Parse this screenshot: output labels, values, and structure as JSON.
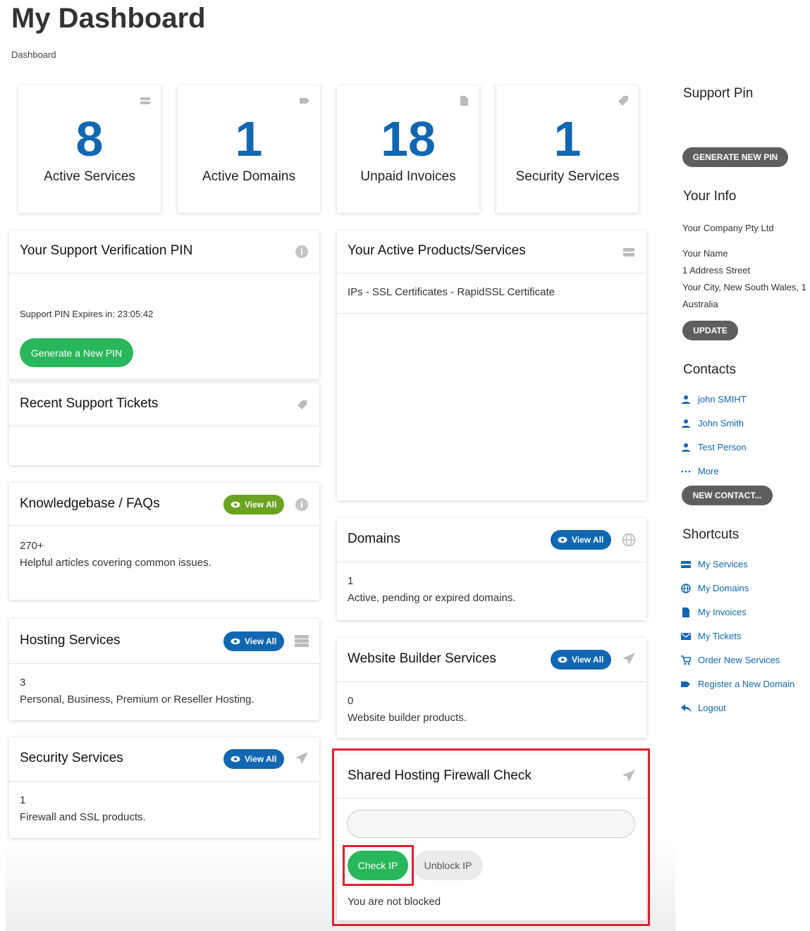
{
  "page": {
    "title": "My Dashboard",
    "breadcrumb": "Dashboard"
  },
  "tiles": [
    {
      "count": "8",
      "label": "Active Services",
      "icon": "server-icon"
    },
    {
      "count": "1",
      "label": "Active Domains",
      "icon": "tag-icon"
    },
    {
      "count": "18",
      "label": "Unpaid Invoices",
      "icon": "file-icon"
    },
    {
      "count": "1",
      "label": "Security Services",
      "icon": "tag-icon"
    }
  ],
  "support_pin_panel": {
    "title": "Your Support Verification PIN",
    "expires": "Support PIN Expires in: 23:05:42",
    "button": "Generate a New PIN"
  },
  "tickets_panel": {
    "title": "Recent Support Tickets"
  },
  "kb_panel": {
    "title": "Knowledgebase / FAQs",
    "view_all": "View All",
    "count": "270+",
    "desc": "Helpful articles covering common issues."
  },
  "hosting_panel": {
    "title": "Hosting Services",
    "view_all": "View All",
    "count": "3",
    "desc": "Personal, Business, Premium or Reseller Hosting."
  },
  "security_panel": {
    "title": "Security Services",
    "view_all": "View All",
    "count": "1",
    "desc": "Firewall and SSL products."
  },
  "products_panel": {
    "title": "Your Active Products/Services",
    "item": "IPs - SSL Certificates - RapidSSL Certificate"
  },
  "domains_panel": {
    "title": "Domains",
    "view_all": "View All",
    "count": "1",
    "desc": "Active, pending or expired domains."
  },
  "builder_panel": {
    "title": "Website Builder Services",
    "view_all": "View All",
    "count": "0",
    "desc": "Website builder products."
  },
  "firewall_panel": {
    "title": "Shared Hosting Firewall Check",
    "input_value": "",
    "check_button": "Check IP",
    "unblock_button": "Unblock IP",
    "status": "You are not blocked"
  },
  "sidebar": {
    "support_pin": {
      "heading": "Support Pin",
      "button": "GENERATE NEW PIN"
    },
    "info": {
      "heading": "Your Info",
      "company": "Your Company Pty Ltd",
      "name": "Your Name",
      "address": "1 Address Street",
      "city": "Your City, New South Wales, 1",
      "country": "Australia",
      "button": "UPDATE"
    },
    "contacts": {
      "heading": "Contacts",
      "items": [
        "john SMIHT",
        "John Smith",
        "Test Person"
      ],
      "more": "More",
      "button": "NEW CONTACT..."
    },
    "shortcuts": {
      "heading": "Shortcuts",
      "items": [
        {
          "label": "My Services",
          "icon": "server-icon"
        },
        {
          "label": "My Domains",
          "icon": "globe-icon"
        },
        {
          "label": "My Invoices",
          "icon": "file-icon"
        },
        {
          "label": "My Tickets",
          "icon": "envelope-icon"
        },
        {
          "label": "Order New Services",
          "icon": "cart-icon"
        },
        {
          "label": "Register a New Domain",
          "icon": "tag-icon"
        },
        {
          "label": "Logout",
          "icon": "reply-icon"
        }
      ]
    }
  },
  "colors": {
    "accent": "#1167b1",
    "green": "#28b75a",
    "olive": "#6aa321",
    "highlight": "#e0202a"
  }
}
